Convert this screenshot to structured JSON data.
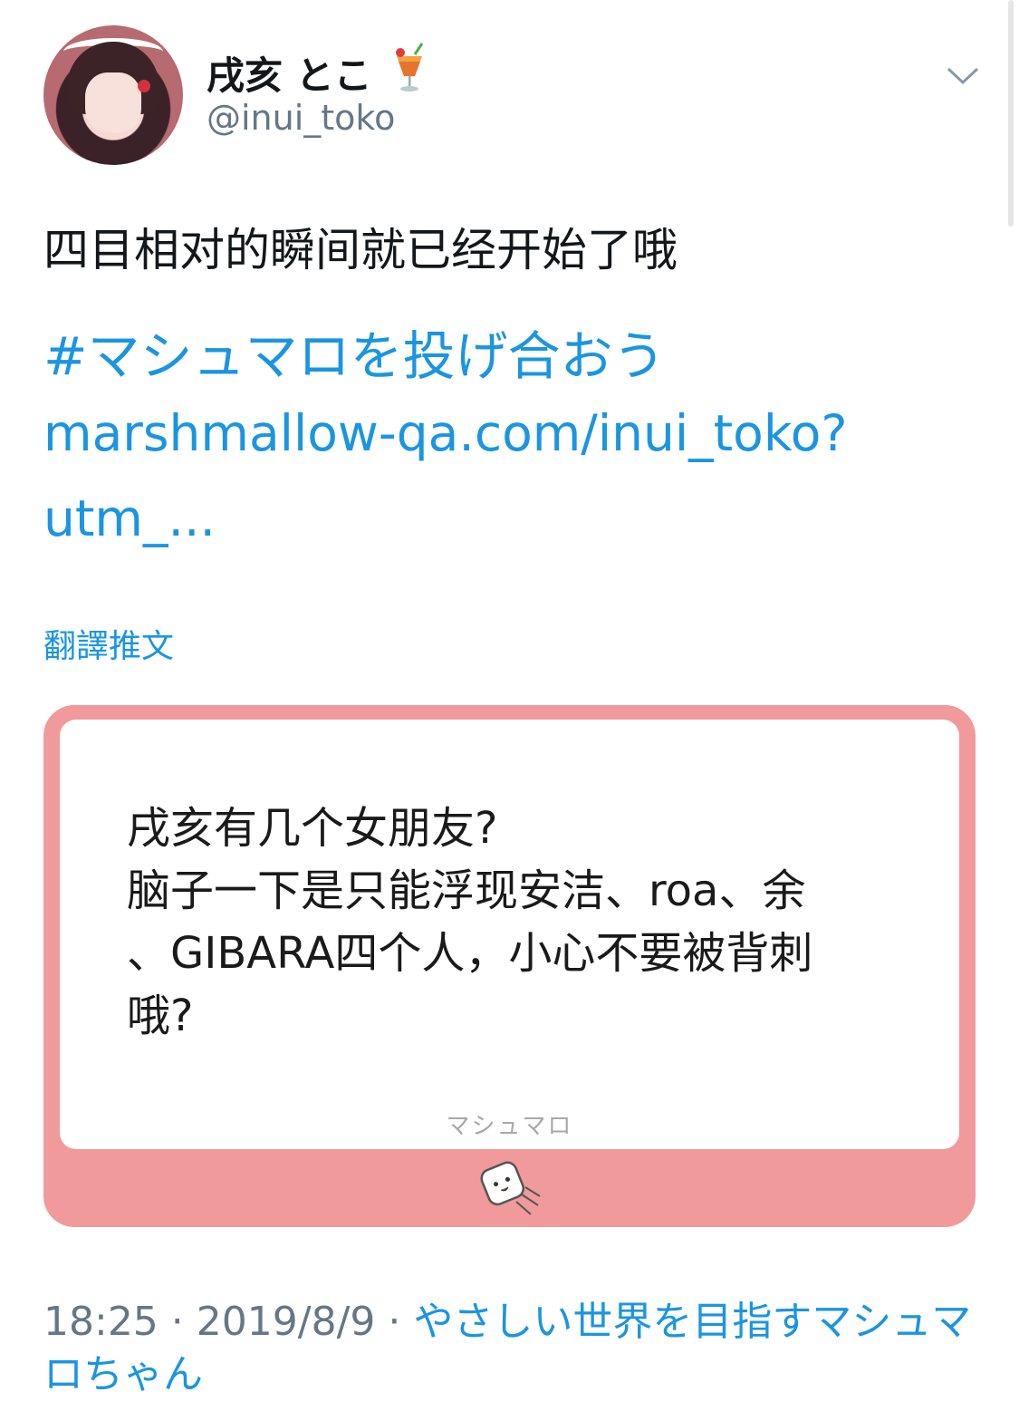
{
  "user": {
    "display_name": "戌亥 とこ",
    "handle": "@inui_toko"
  },
  "tweet": {
    "text": "四目相对的瞬间就已经开始了哦",
    "hashtag": "#マシュマロを投げ合おう",
    "url_line1": "marshmallow-qa.com/inui_toko?",
    "url_line2": "utm_...",
    "translate_label": "翻譯推文"
  },
  "card": {
    "question": "戌亥有几个女朋友?\n脑子一下是只能浮现安洁、roa、余\n、GIBARA四个人，小心不要被背刺\n哦?",
    "brand": "マシュマロ",
    "border_color": "#f09a9c"
  },
  "meta": {
    "time": "18:25",
    "separator": " · ",
    "date": "2019/8/9",
    "source": "やさしい世界を目指すマシュマロちゃん"
  },
  "icons": {
    "drink": "tropical-drink-icon",
    "chevron": "chevron-down-icon",
    "marshmallow": "marshmallow-icon"
  },
  "colors": {
    "link": "#1b95e0",
    "secondary_text": "#657786"
  }
}
